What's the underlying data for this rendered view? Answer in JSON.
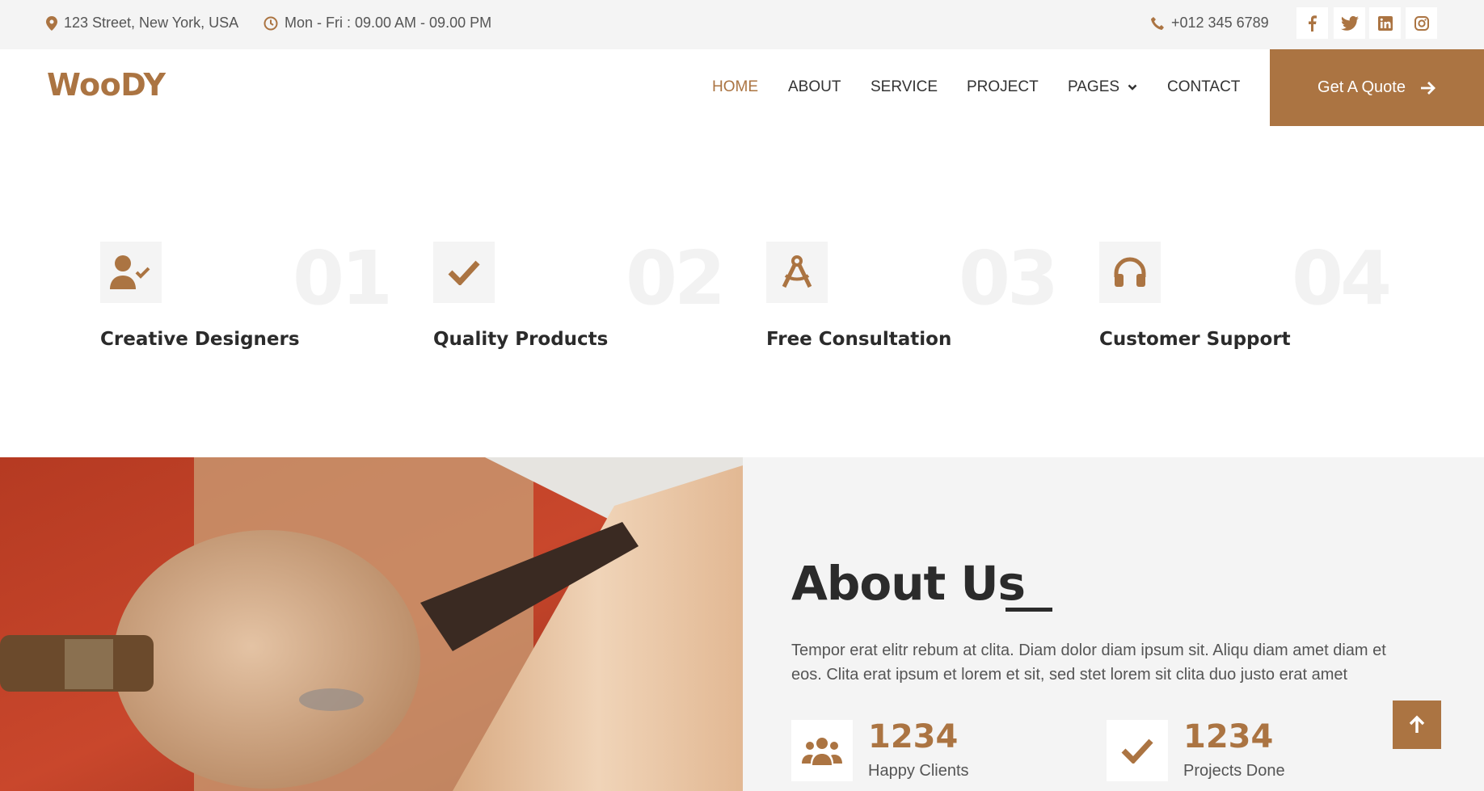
{
  "topbar": {
    "address": "123 Street, New York, USA",
    "hours": "Mon - Fri : 09.00 AM - 09.00 PM",
    "phone": "+012 345 6789",
    "social": [
      "facebook-icon",
      "twitter-icon",
      "linkedin-icon",
      "instagram-icon"
    ]
  },
  "navbar": {
    "logo": "WooDY",
    "items": [
      "HOME",
      "ABOUT",
      "SERVICE",
      "PROJECT",
      "PAGES",
      "CONTACT"
    ],
    "active": "HOME",
    "cta": "Get A Quote"
  },
  "features": [
    {
      "number": "01",
      "title": "Creative Designers",
      "icon": "user-check-icon"
    },
    {
      "number": "02",
      "title": "Quality Products",
      "icon": "check-icon"
    },
    {
      "number": "03",
      "title": "Free Consultation",
      "icon": "drafting-compass-icon"
    },
    {
      "number": "04",
      "title": "Customer Support",
      "icon": "headphones-icon"
    }
  ],
  "about": {
    "title": "About Us",
    "text": "Tempor erat elitr rebum at clita. Diam dolor diam ipsum sit. Aliqu diam amet diam et eos. Clita erat ipsum et lorem et sit, sed stet lorem sit clita duo justo erat amet",
    "stats": [
      {
        "value": "1234",
        "label": "Happy Clients",
        "icon": "users-icon"
      },
      {
        "value": "1234",
        "label": "Projects Done",
        "icon": "check-icon"
      }
    ]
  },
  "colors": {
    "accent": "#ab7442",
    "light_bg": "#f4f4f4",
    "text_dark": "#2b2b2b"
  }
}
